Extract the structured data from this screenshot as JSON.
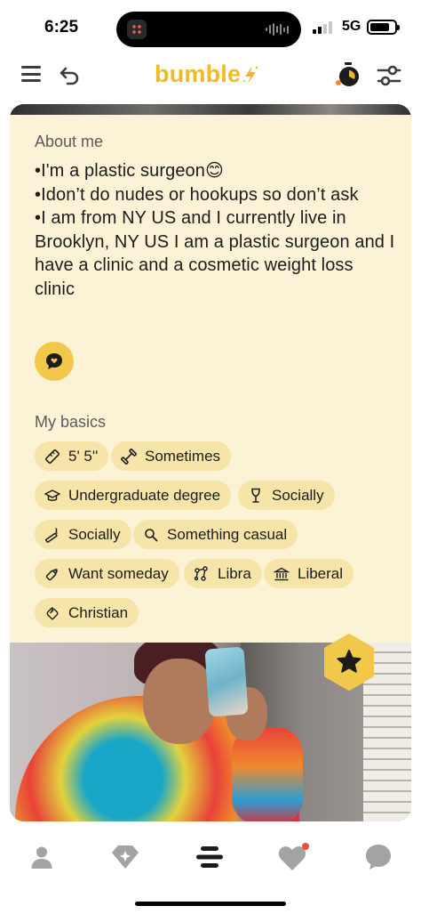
{
  "status_bar": {
    "time": "6:25",
    "network": "5G",
    "signal_bars_active": 2,
    "signal_bars_total": 4,
    "battery_level": 0.82
  },
  "app_bar": {
    "logo_text": "bumble",
    "icons": [
      "menu-icon",
      "undo-icon",
      "bolt-icon",
      "stopwatch-icon",
      "filter-icon"
    ]
  },
  "profile": {
    "about_title": "About me",
    "about_text": "•I'm a plastic surgeon😊\n•Idon’t do nudes or hookups so don’t ask\n•I am from NY US and I currently live in Brooklyn, NY US I am a plastic surgeon and I have a clinic and a cosmetic weight loss clinic",
    "basics_title": "My basics",
    "basics": [
      {
        "icon": "ruler-icon",
        "label": "5' 5''"
      },
      {
        "icon": "dumbbell-icon",
        "label": "Sometimes"
      },
      {
        "icon": "graduation-cap-icon",
        "label": "Undergraduate degree"
      },
      {
        "icon": "wine-glass-icon",
        "label": "Socially"
      },
      {
        "icon": "cigarette-icon",
        "label": "Socially"
      },
      {
        "icon": "magnifier-icon",
        "label": "Something casual"
      },
      {
        "icon": "baby-bottle-icon",
        "label": "Want someday"
      },
      {
        "icon": "zodiac-icon",
        "label": "Libra"
      },
      {
        "icon": "capitol-icon",
        "label": "Liberal"
      },
      {
        "icon": "praying-hands-icon",
        "label": "Christian"
      }
    ]
  },
  "bottom_nav": {
    "items": [
      "profile-icon",
      "discover-icon",
      "people-icon",
      "liked-you-icon",
      "chats-icon"
    ],
    "active": "people-icon",
    "notification_on": "liked-you-icon"
  },
  "colors": {
    "brand": "#f0b92a",
    "card_background": "#fcf3d6",
    "chip_background": "#f6e4a9",
    "accent_button": "#f2c84b",
    "notification_dot": "#e8503a"
  }
}
